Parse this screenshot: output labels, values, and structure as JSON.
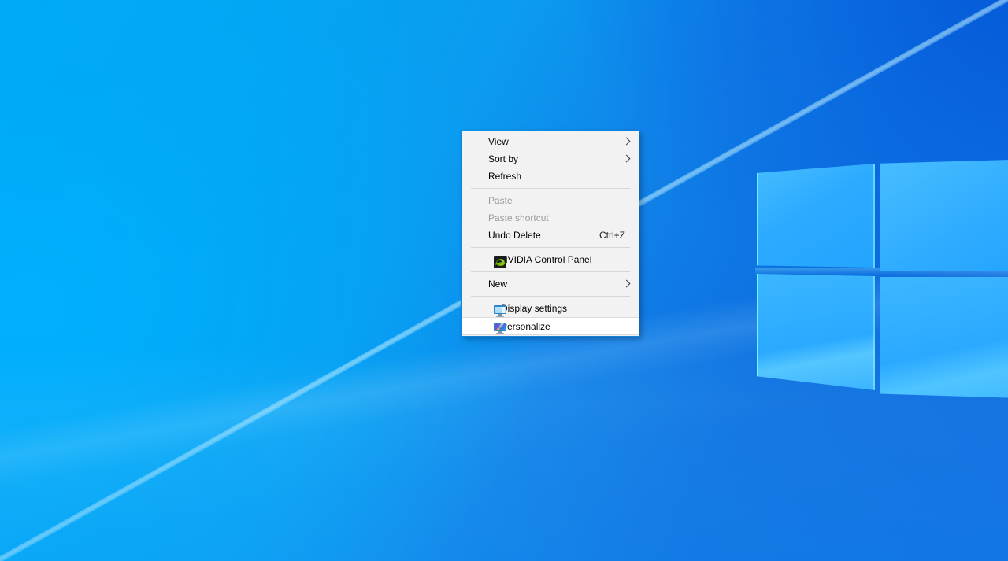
{
  "desktop": {
    "name": "Windows 10 Desktop",
    "wallpaper_name": "windows-10-hero-wallpaper",
    "colors": {
      "accent_blue": "#0078d7",
      "wallpaper_light": "#00aaf5",
      "wallpaper_dark": "#0c68dd",
      "pane_fill": "#2caaff",
      "pane_glow": "#78faff"
    }
  },
  "context_menu": {
    "name": "desktop-context-menu",
    "border_color": "#1683d8",
    "background": "#f2f2f2",
    "groups": [
      {
        "items": [
          {
            "label": "View",
            "accel": "",
            "submenu": true,
            "disabled": false,
            "hovered": false,
            "icon": ""
          },
          {
            "label": "Sort by",
            "accel": "",
            "submenu": true,
            "disabled": false,
            "hovered": false,
            "icon": ""
          },
          {
            "label": "Refresh",
            "accel": "",
            "submenu": false,
            "disabled": false,
            "hovered": false,
            "icon": ""
          }
        ]
      },
      {
        "items": [
          {
            "label": "Paste",
            "accel": "",
            "submenu": false,
            "disabled": true,
            "hovered": false,
            "icon": ""
          },
          {
            "label": "Paste shortcut",
            "accel": "",
            "submenu": false,
            "disabled": true,
            "hovered": false,
            "icon": ""
          },
          {
            "label": "Undo Delete",
            "accel": "Ctrl+Z",
            "submenu": false,
            "disabled": false,
            "hovered": false,
            "icon": ""
          }
        ]
      },
      {
        "items": [
          {
            "label": "NVIDIA Control Panel",
            "accel": "",
            "submenu": false,
            "disabled": false,
            "hovered": false,
            "icon": "nvidia-icon"
          }
        ]
      },
      {
        "items": [
          {
            "label": "New",
            "accel": "",
            "submenu": true,
            "disabled": false,
            "hovered": false,
            "icon": ""
          }
        ]
      },
      {
        "items": [
          {
            "label": "Display settings",
            "accel": "",
            "submenu": false,
            "disabled": false,
            "hovered": false,
            "icon": "display-settings-icon"
          },
          {
            "label": "Personalize",
            "accel": "",
            "submenu": false,
            "disabled": false,
            "hovered": true,
            "icon": "personalize-icon"
          }
        ]
      }
    ]
  }
}
